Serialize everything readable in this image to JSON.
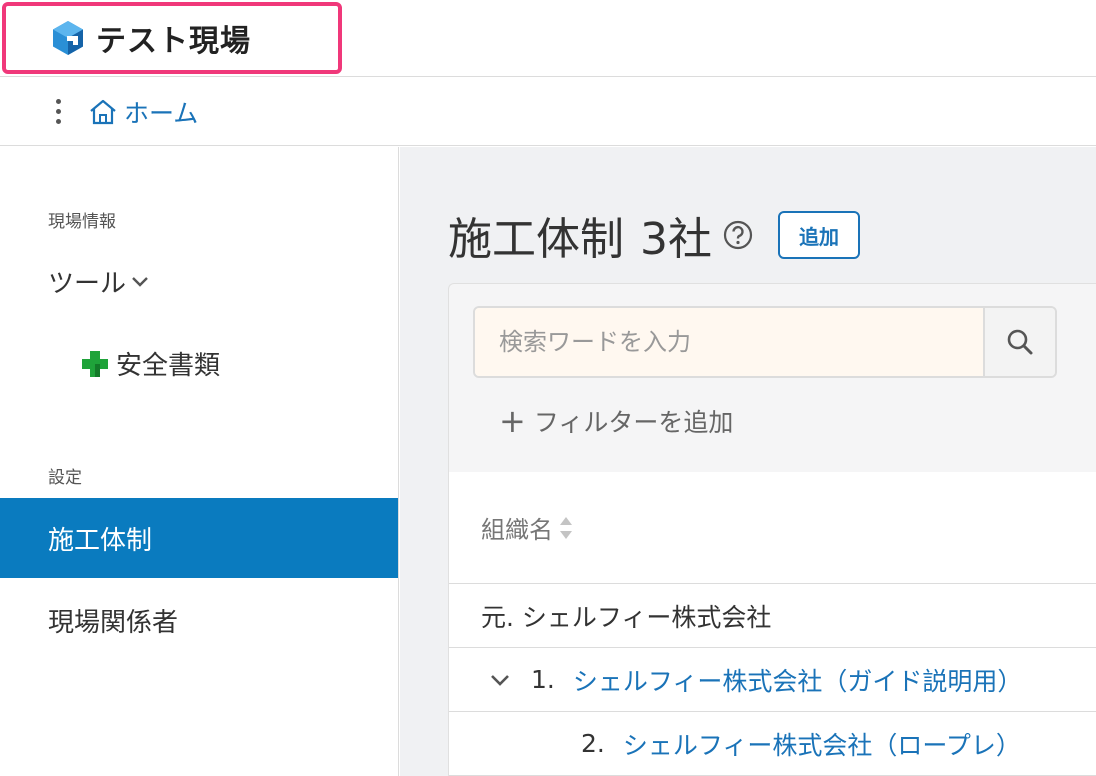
{
  "site": {
    "title": "テスト現場"
  },
  "breadcrumb": {
    "home_label": "ホーム"
  },
  "sidebar": {
    "section_info": "現場情報",
    "tools_label": "ツール",
    "safety_docs_label": "安全書類",
    "section_settings": "設定",
    "active_item_label": "施工体制",
    "stakeholders_label": "現場関係者"
  },
  "main": {
    "title": "施工体制",
    "count": "3社",
    "add_button": "追加",
    "search_placeholder": "検索ワードを入力",
    "add_filter_label": "フィルターを追加",
    "table": {
      "column_header": "組織名",
      "rows": [
        {
          "label": "元. シェルフィー株式会社"
        },
        {
          "number": "1.",
          "name": "シェルフィー株式会社（ガイド説明用）"
        },
        {
          "number": "2.",
          "name": "シェルフィー株式会社（ロープレ）"
        }
      ]
    }
  },
  "colors": {
    "accent": "#0a7bbf",
    "link": "#1a73b8",
    "highlight_border": "#f0387a",
    "safety_cross": "#1fa33a"
  }
}
